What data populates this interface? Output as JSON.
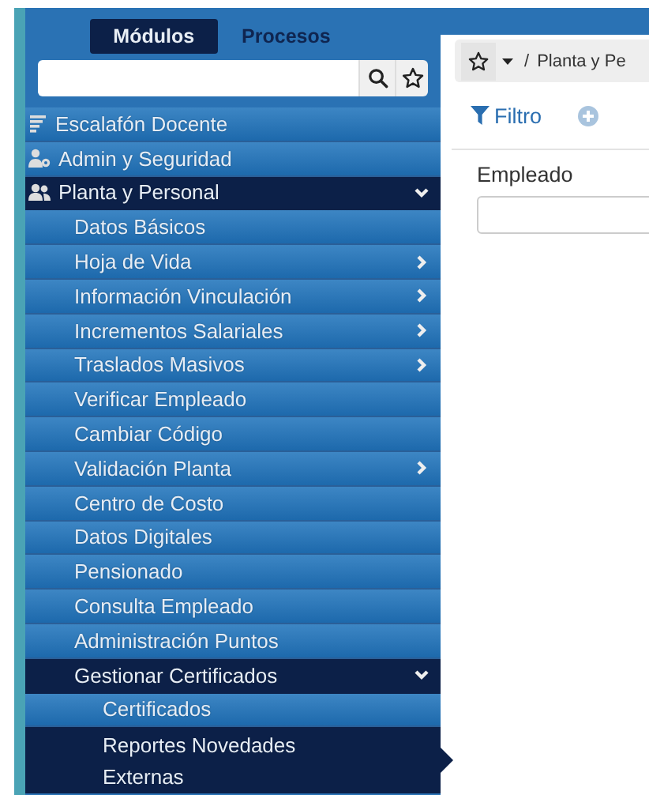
{
  "tabs": [
    {
      "label": "Módulos",
      "selected": true
    },
    {
      "label": "Procesos",
      "selected": false
    }
  ],
  "menu": [
    {
      "label": "Escalafón Docente",
      "kind": "list",
      "selected": false
    },
    {
      "label": "Admin y Seguridad",
      "kind": "user-gear",
      "selected": false
    },
    {
      "label": "Planta y Personal",
      "kind": "users",
      "selected": true,
      "expanded": true,
      "children": [
        {
          "label": "Datos Básicos",
          "selected": false
        },
        {
          "label": "Hoja de Vida",
          "selected": false,
          "expanded": false
        },
        {
          "label": "Información Vinculación",
          "selected": false,
          "expanded": false
        },
        {
          "label": "Incrementos Salariales",
          "selected": false,
          "expanded": false
        },
        {
          "label": "Traslados Masivos",
          "selected": false,
          "expanded": false
        },
        {
          "label": "Verificar Empleado",
          "selected": false
        },
        {
          "label": "Cambiar Código",
          "selected": false
        },
        {
          "label": "Validación Planta",
          "selected": false,
          "expanded": false
        },
        {
          "label": "Centro de Costo",
          "selected": false
        },
        {
          "label": "Datos Digitales",
          "selected": false
        },
        {
          "label": "Pensionado",
          "selected": false
        },
        {
          "label": "Consulta Empleado",
          "selected": false
        },
        {
          "label": "Administración Puntos",
          "selected": false
        },
        {
          "label": "Gestionar Certificados",
          "selected": true,
          "expanded": true,
          "children": [
            {
              "label": "Certificados",
              "selected": false
            },
            {
              "label": "Reportes Novedades Externas",
              "selected": true
            }
          ]
        }
      ]
    }
  ],
  "breadcrumb": {
    "separator": "/",
    "path": "Planta y Pe"
  },
  "toolbar": {
    "filter_label": "Filtro"
  },
  "form": {
    "field_label": "Empleado"
  }
}
